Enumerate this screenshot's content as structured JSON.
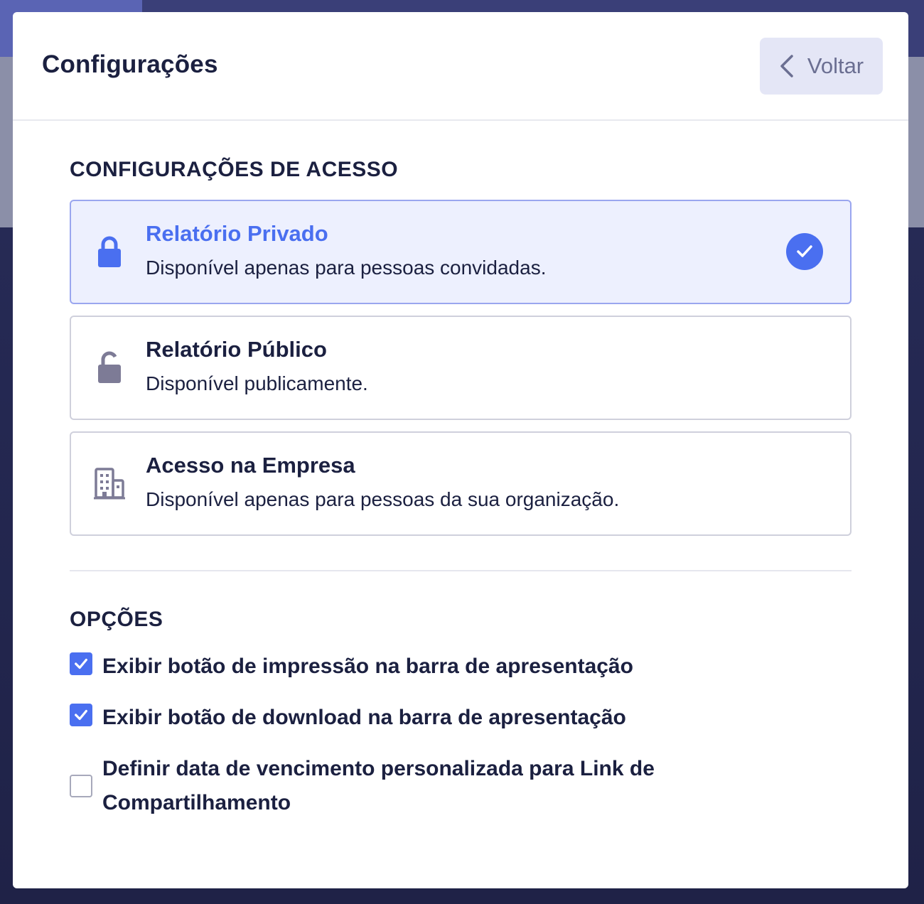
{
  "modal": {
    "title": "Configurações",
    "back_label": "Voltar"
  },
  "access_section": {
    "title": "CONFIGURAÇÕES DE ACESSO",
    "options": [
      {
        "title": "Relatório Privado",
        "description": "Disponível apenas para pessoas convidadas.",
        "icon": "lock-icon",
        "selected": true
      },
      {
        "title": "Relatório Público",
        "description": "Disponível publicamente.",
        "icon": "unlock-icon",
        "selected": false
      },
      {
        "title": "Acesso na Empresa",
        "description": "Disponível apenas para pessoas da sua organização.",
        "icon": "building-icon",
        "selected": false
      }
    ]
  },
  "options_section": {
    "title": "OPÇÕES",
    "checkboxes": [
      {
        "prefix": "Exibir botão de ",
        "bold": "impressão",
        "suffix": " na barra de apresentação",
        "checked": true
      },
      {
        "prefix": "Exibir botão de ",
        "bold": "download",
        "suffix": " na barra de apresentação",
        "checked": true
      },
      {
        "prefix": "Definir data de vencimento personalizada para Link de Compartilhamento",
        "bold": "",
        "suffix": "",
        "checked": false
      }
    ]
  },
  "colors": {
    "accent": "#4a6ff0",
    "selected_bg": "#edf0fe",
    "text": "#1b2040",
    "muted_icon": "#7d7b96"
  }
}
